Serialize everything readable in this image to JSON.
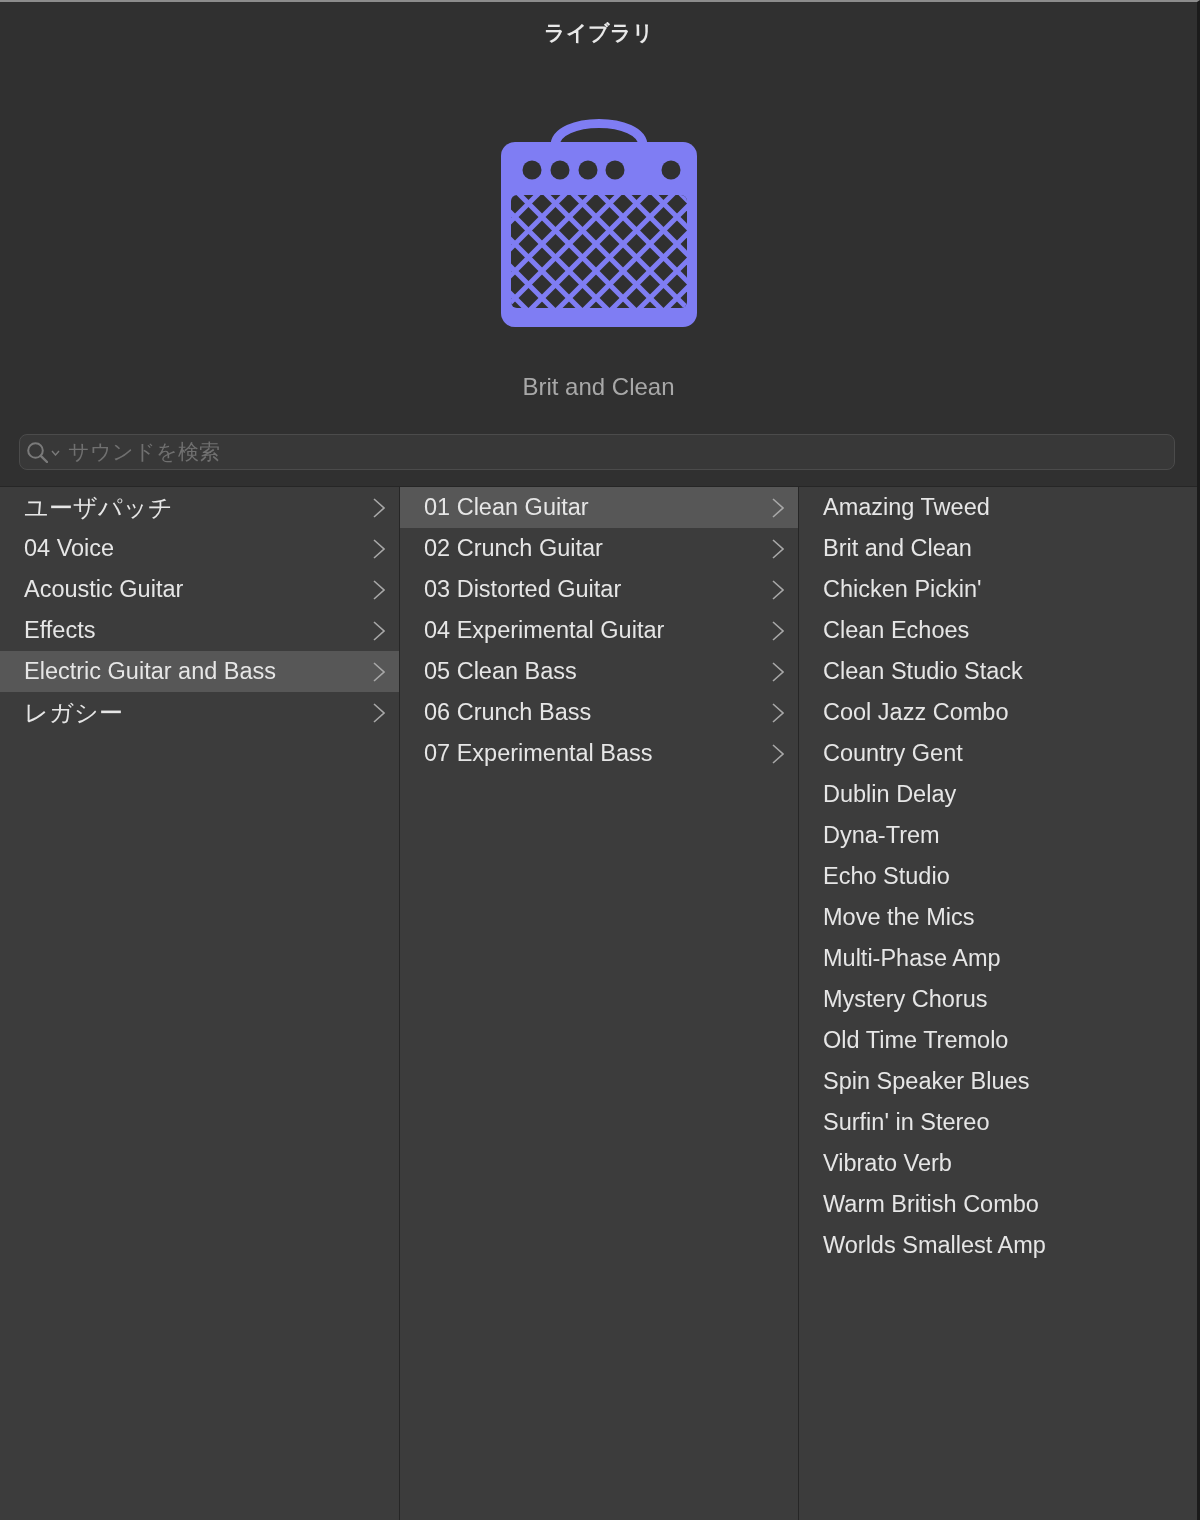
{
  "window": {
    "title": "ライブラリ"
  },
  "preview": {
    "patch_name": "Brit and Clean"
  },
  "search": {
    "placeholder": "サウンドを検索"
  },
  "columns": [
    {
      "items": [
        {
          "label": "ユーザパッチ",
          "selected": false,
          "expandable": true
        },
        {
          "label": "04 Voice",
          "selected": false,
          "expandable": true
        },
        {
          "label": "Acoustic Guitar",
          "selected": false,
          "expandable": true
        },
        {
          "label": "Effects",
          "selected": false,
          "expandable": true
        },
        {
          "label": "Electric Guitar and Bass",
          "selected": true,
          "expandable": true
        },
        {
          "label": "レガシー",
          "selected": false,
          "expandable": true
        }
      ]
    },
    {
      "items": [
        {
          "label": "01 Clean Guitar",
          "selected": true,
          "expandable": true
        },
        {
          "label": "02 Crunch Guitar",
          "selected": false,
          "expandable": true
        },
        {
          "label": "03 Distorted Guitar",
          "selected": false,
          "expandable": true
        },
        {
          "label": "04 Experimental Guitar",
          "selected": false,
          "expandable": true
        },
        {
          "label": "05 Clean Bass",
          "selected": false,
          "expandable": true
        },
        {
          "label": "06 Crunch Bass",
          "selected": false,
          "expandable": true
        },
        {
          "label": "07 Experimental Bass",
          "selected": false,
          "expandable": true
        }
      ]
    },
    {
      "items": [
        {
          "label": "Amazing Tweed",
          "selected": false,
          "expandable": false
        },
        {
          "label": "Brit and Clean",
          "selected": false,
          "expandable": false
        },
        {
          "label": "Chicken Pickin'",
          "selected": false,
          "expandable": false
        },
        {
          "label": "Clean Echoes",
          "selected": false,
          "expandable": false
        },
        {
          "label": "Clean Studio Stack",
          "selected": false,
          "expandable": false
        },
        {
          "label": "Cool Jazz Combo",
          "selected": false,
          "expandable": false
        },
        {
          "label": "Country Gent",
          "selected": false,
          "expandable": false
        },
        {
          "label": "Dublin Delay",
          "selected": false,
          "expandable": false
        },
        {
          "label": "Dyna-Trem",
          "selected": false,
          "expandable": false
        },
        {
          "label": "Echo Studio",
          "selected": false,
          "expandable": false
        },
        {
          "label": "Move the Mics",
          "selected": false,
          "expandable": false
        },
        {
          "label": "Multi-Phase Amp",
          "selected": false,
          "expandable": false
        },
        {
          "label": "Mystery Chorus",
          "selected": false,
          "expandable": false
        },
        {
          "label": "Old Time Tremolo",
          "selected": false,
          "expandable": false
        },
        {
          "label": "Spin Speaker Blues",
          "selected": false,
          "expandable": false
        },
        {
          "label": "Surfin' in Stereo",
          "selected": false,
          "expandable": false
        },
        {
          "label": "Vibrato Verb",
          "selected": false,
          "expandable": false
        },
        {
          "label": "Warm British Combo",
          "selected": false,
          "expandable": false
        },
        {
          "label": "Worlds Smallest Amp",
          "selected": false,
          "expandable": false
        }
      ]
    }
  ]
}
